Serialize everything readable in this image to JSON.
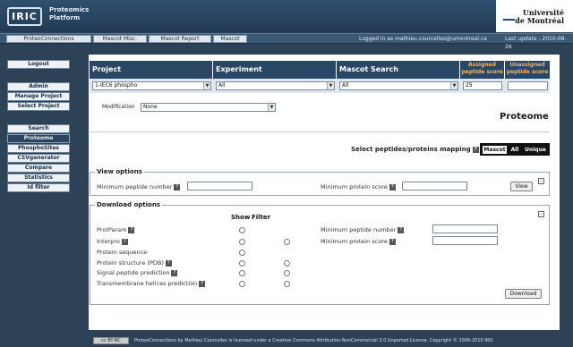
{
  "header": {
    "logo_text": "IRIC",
    "app_title": "Proteomics\nPlatform",
    "university": "Université\nde Montréal"
  },
  "nav": {
    "tabs": [
      "ProteoConnections",
      "Mascot Misc.",
      "Mascot Report",
      "Mascot"
    ],
    "logged_in": "Logged in as mathieu.courcelles@umontreal.ca",
    "last_update": "Last update : 2010-08-26"
  },
  "sidebar": {
    "logout": "Logout",
    "admin": "Admin",
    "manage_project": "Manage Project",
    "select_project": "Select Project",
    "search": "Search",
    "proteome": "Proteome",
    "phosphosites": "PhosphoSites",
    "csvgenerator": "CSVgenerator",
    "compare": "Compare",
    "statistics": "Statistics",
    "id_filter": "Id filter"
  },
  "filters": {
    "project_header": "Project",
    "experiment_header": "Experiment",
    "mascot_search_header": "Mascot Search",
    "assigned_header": "Assigned peptide score",
    "unassigned_header": "Unassigned peptide score",
    "project_value": "1-IEC6 phospho",
    "experiment_value": "All",
    "mascot_search_value": "All",
    "assigned_value": "25",
    "unassigned_value": ""
  },
  "modification": {
    "label": "Modification",
    "value": "None"
  },
  "page_title": "Proteome",
  "mapping": {
    "label": "Select peptides/proteins mapping",
    "options": [
      "Mascot",
      "All",
      "Unique"
    ],
    "selected": "All"
  },
  "view_options": {
    "legend": "View options",
    "min_peptide_label": "Minimum peptide number",
    "min_protein_label": "Minimum protein score",
    "view_button": "View"
  },
  "download_options": {
    "legend": "Download options",
    "col_show": "Show",
    "col_filter": "Filter",
    "rows": [
      "ProtParam",
      "Interpro",
      "Protein sequence",
      "Protein structure (PDB)",
      "Signal peptide prediction",
      "Transmembrane helices prediction"
    ],
    "min_peptide_label": "Minimum peptide number",
    "min_protein_label": "Minimum protein score",
    "download_button": "Download"
  },
  "footer": {
    "badge": "cc BY-NC",
    "text": "ProteoConnections by Mathieu Courcelles is licensed under a Creative Commons Attribution-NonCommercial 3.0 Unported License. Copyright © 2006-2010 IRIC"
  },
  "colors": {
    "background": "#2e4257",
    "header_bar": "#2a4865",
    "accent_orange": "#f2b36b"
  }
}
